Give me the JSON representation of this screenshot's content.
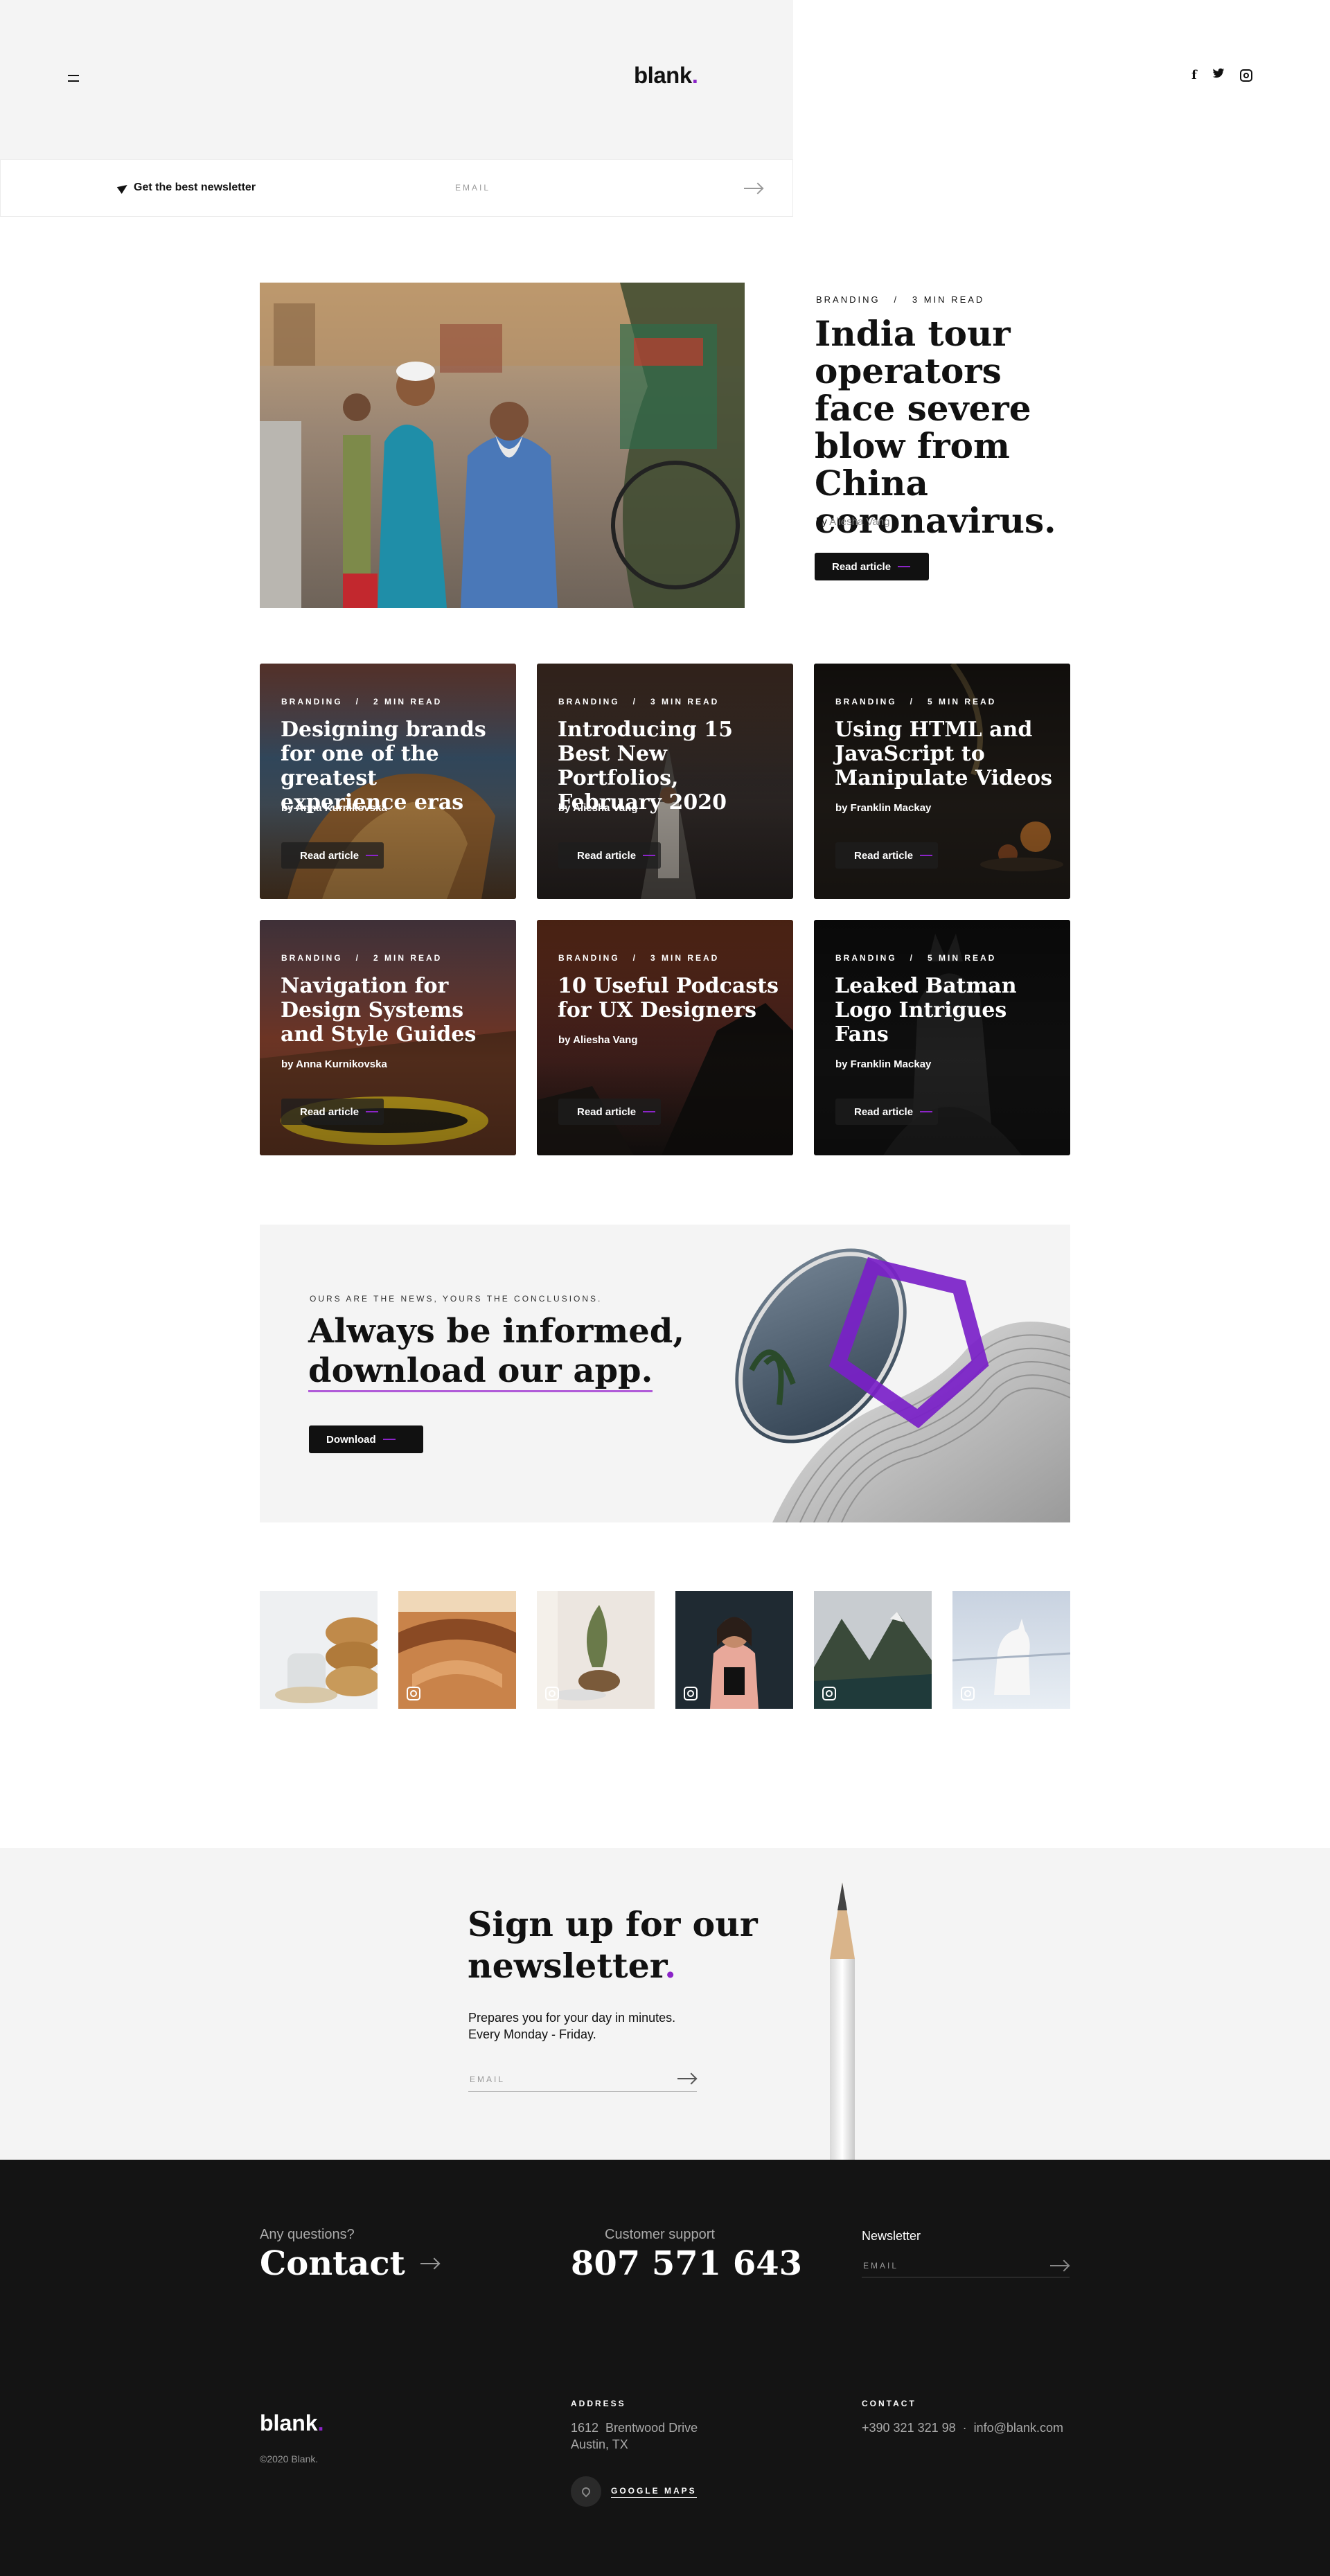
{
  "header": {
    "logo": "blank",
    "logo_dot": ".",
    "socials": [
      "facebook-icon",
      "twitter-icon",
      "instagram-icon"
    ]
  },
  "newsletter_bar": {
    "label": "Get the best newsletter",
    "email_placeholder": "EMAIL"
  },
  "hero": {
    "meta": "BRANDING   /   3 MIN READ",
    "title": "India tour operators face severe blow from China coronavirus.",
    "by": "by",
    "author": "Aliesha Vang",
    "button": "Read article"
  },
  "cards": [
    {
      "meta": "BRANDING   /   2 MIN READ",
      "title": "Designing brands for one of the greatest experience eras",
      "author": "by Anna Kurnikovska",
      "button": "Read article"
    },
    {
      "meta": "BRANDING   /   3 MIN READ",
      "title": "Introducing 15 Best New Portfolios, February 2020",
      "author": "by Aliesha Vang",
      "button": "Read article"
    },
    {
      "meta": "BRANDING   /   5 MIN READ",
      "title": "Using HTML and JavaScript to Manipulate Videos",
      "author": "by Franklin Mackay",
      "button": "Read article"
    },
    {
      "meta": "BRANDING   /   2 MIN READ",
      "title": "Navigation for Design Systems and Style Guides",
      "author": "by Anna Kurnikovska",
      "button": "Read article"
    },
    {
      "meta": "BRANDING   /   3 MIN READ",
      "title": "10 Useful Podcasts for UX Designers",
      "author": "by Aliesha Vang",
      "button": "Read article"
    },
    {
      "meta": "BRANDING   /   5 MIN READ",
      "title": "Leaked Batman Logo Intrigues Fans",
      "author": "by Franklin Mackay",
      "button": "Read article"
    }
  ],
  "app_banner": {
    "kicker": "OURS ARE THE NEWS, YOURS THE CONCLUSIONS.",
    "title_line1": "Always be informed,",
    "title_line2": "download our app.",
    "button": "Download"
  },
  "signup": {
    "title_line1": "Sign up for our",
    "title_line2": "newsletter",
    "title_dot": ".",
    "desc_line1": "Prepares you for your day in minutes.",
    "desc_line2": "Every Monday - Friday.",
    "email_placeholder": "EMAIL"
  },
  "footer": {
    "questions": "Any questions?",
    "contact": "Contact",
    "support": "Customer support",
    "phone": "807 571 643",
    "newsletter": "Newsletter",
    "email_placeholder": "EMAIL",
    "logo": "blank",
    "logo_dot": ".",
    "copyright": "©2020 Blank.",
    "address_heading": "ADDRESS",
    "address_line1": "1612  Brentwood Drive",
    "address_line2": "Austin, TX",
    "maps": "GOOGLE MAPS",
    "contact_heading": "CONTACT",
    "contact_line": "+390 321 321 98  ·  info@blank.com"
  },
  "colors": {
    "accent": "#8b24c8",
    "dark": "#111111",
    "footer_bg": "#141414",
    "light_bg": "#f4f4f4"
  }
}
